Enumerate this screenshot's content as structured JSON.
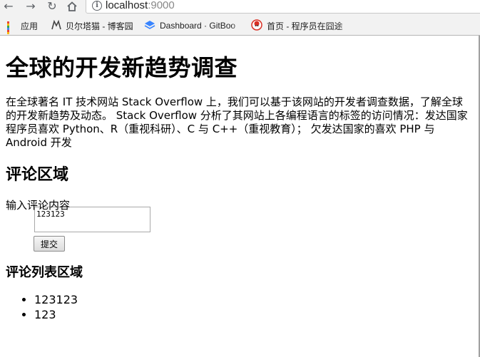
{
  "browser": {
    "url_host": "localhost",
    "url_port": ":9000",
    "bookmarks": [
      {
        "label": "应用",
        "icon": "apps-grid-icon"
      },
      {
        "label": "贝尔塔猫 - 博客园",
        "icon": "cat-icon"
      },
      {
        "label": "Dashboard · GitBoo",
        "icon": "gitbook-icon"
      },
      {
        "label": "首页 - 程序员在囧途",
        "icon": "avatar-icon"
      }
    ],
    "colors": {
      "grid": [
        "#ea4335",
        "#fbbc05",
        "#34a853",
        "#4285f4",
        "#ea4335",
        "#fbbc05",
        "#34a853",
        "#4285f4",
        "#ea4335"
      ],
      "gitbook": "#3884ff",
      "avatar": "#d93025"
    }
  },
  "page": {
    "title": "全球的开发新趋势调查",
    "intro": "在全球著名 IT 技术网站 Stack Overflow 上，我们可以基于该网站的开发者调查数据，了解全球的开发新趋势及动态。 Stack Overflow 分析了其网站上各编程语言的标签的访问情况：发达国家程序员喜欢 Python、R（重视科研）、C 与 C++（重视教育）； 欠发达国家的喜欢 PHP 与 Android 开发",
    "comment_section_title": "评论区域",
    "comment_label": "输入评论内容",
    "comment_value": "123123",
    "submit_label": "提交",
    "list_section_title": "评论列表区域",
    "comments": [
      "123123",
      "123"
    ]
  }
}
